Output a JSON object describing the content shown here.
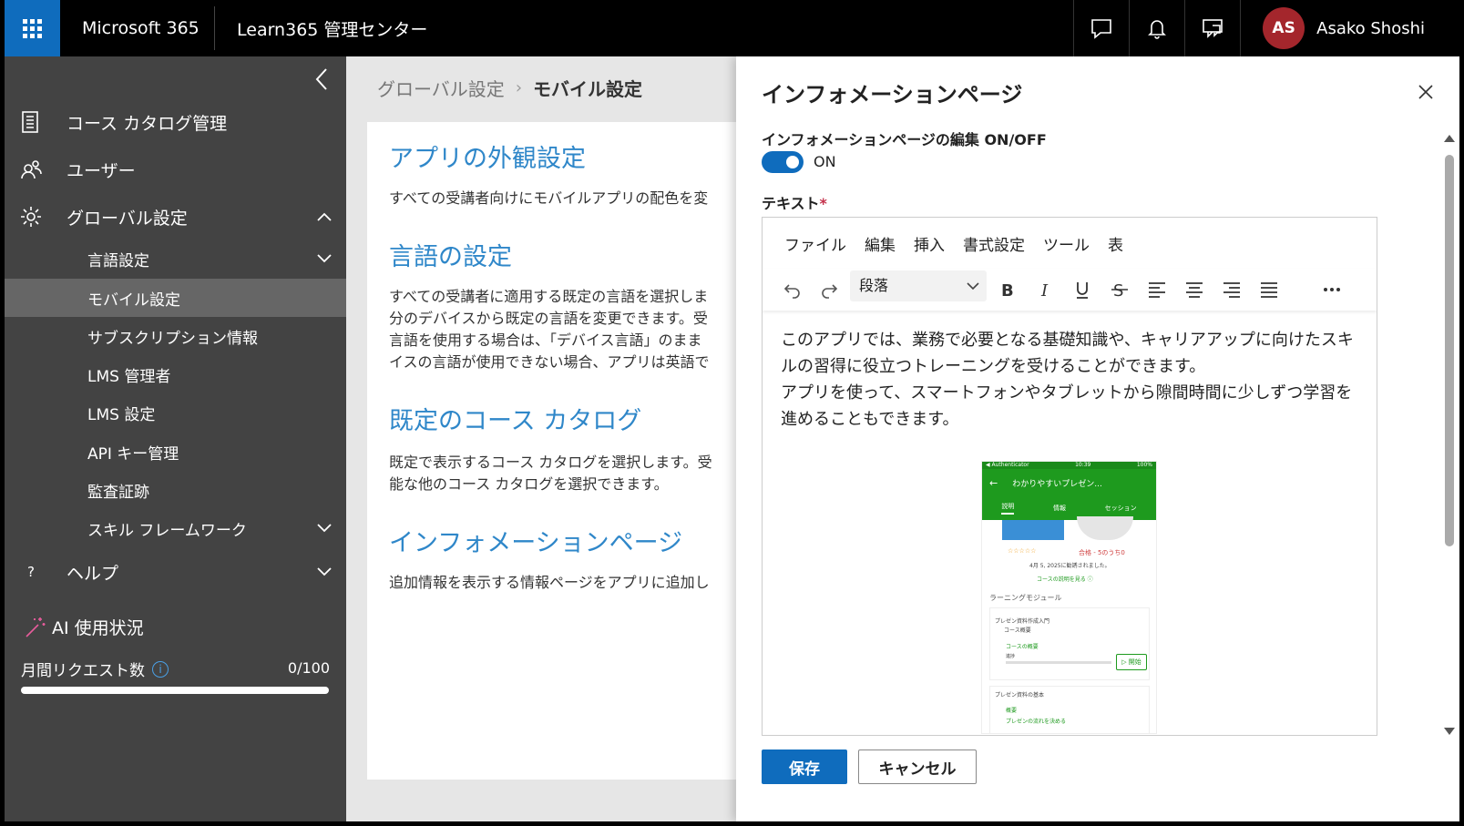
{
  "topbar": {
    "brand": "Microsoft 365",
    "app_title": "Learn365 管理センター",
    "icons": [
      "waffle-icon",
      "chat-icon",
      "bell-icon",
      "feedback-icon"
    ],
    "user": {
      "initials": "AS",
      "name": "Asako Shoshi",
      "avatar_color": "#a4262c"
    }
  },
  "sidebar": {
    "items": [
      {
        "label": "コース カタログ管理",
        "icon": "catalog-icon"
      },
      {
        "label": "ユーザー",
        "icon": "users-icon"
      },
      {
        "label": "グローバル設定",
        "icon": "gear-icon"
      },
      {
        "label": "ヘルプ",
        "icon": "question-icon"
      }
    ],
    "subitems": [
      {
        "label": "言語設定"
      },
      {
        "label": "モバイル設定"
      },
      {
        "label": "サブスクリプション情報"
      },
      {
        "label": "LMS 管理者"
      },
      {
        "label": "LMS 設定"
      },
      {
        "label": "API キー管理"
      },
      {
        "label": "監査証跡"
      },
      {
        "label": "スキル フレームワーク"
      }
    ],
    "ai_title": "AI 使用状況",
    "request_label": "月間リクエスト数",
    "request_count": "0/100",
    "request_fraction": 0
  },
  "main": {
    "breadcrumb_parent": "グローバル設定",
    "breadcrumb_current": "モバイル設定",
    "sections": [
      {
        "heading": "アプリの外観設定",
        "body": "すべての受講者向けにモバイルアプリの配色を変"
      },
      {
        "heading": "言語の設定",
        "body": "すべての受講者に適用する既定の言語を選択しま\n分のデバイスから既定の言語を変更できます。受\n言語を使用する場合は、「デバイス言語」のまま\nイスの言語が使用できない場合、アプリは英語で"
      },
      {
        "heading": "既定のコース カタログ",
        "body": "既定で表示するコース カタログを選択します。受\n能な他のコース カタログを選択できます。"
      },
      {
        "heading": "インフォメーションページ",
        "body": "追加情報を表示する情報ページをアプリに追加し"
      }
    ]
  },
  "panel": {
    "title": "インフォメーションページ",
    "toggle_label": "インフォメーションページの編集 ON/OFF",
    "toggle_state": "ON",
    "text_label": "テキスト",
    "required_mark": "*",
    "editor": {
      "menu": [
        "ファイル",
        "編集",
        "挿入",
        "書式設定",
        "ツール",
        "表"
      ],
      "format_select": "段落",
      "paragraph1": "このアプリでは、業務で必要となる基礎知識や、キャリアアップに向けたスキルの習得に役立つトレーニングを受けることができます。",
      "paragraph2": "アプリを使って、スマートフォンやタブレットから隙間時間に少しずつ学習を進めることもできます。",
      "image": {
        "status_left": "◀ Authenticator",
        "status_time": "10:39",
        "status_right": "100%",
        "header": "わかりやすいプレゼン...",
        "tabs": [
          "説明",
          "情報",
          "セッション"
        ],
        "rating_text": "合格 - 5のうち0",
        "date_text": "4月 5, 2025に勧誘されました。",
        "link_text": "コースの説明を見る ⓘ",
        "section_title": "ラーニングモジュール",
        "module1": "プレゼン資料作成入門",
        "module1_sub": "コース概要",
        "item1": "コースの概要",
        "progress_label": "進捗",
        "start_label": "▷ 開始",
        "module2": "プレゼン資料の基本",
        "item2": "概要",
        "item3": "プレゼンの流れを決める"
      }
    },
    "save_label": "保存",
    "cancel_label": "キャンセル",
    "accent_color": "#0f6cbd"
  }
}
